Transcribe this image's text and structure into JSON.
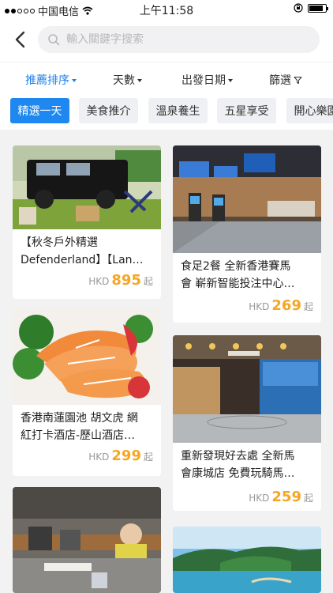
{
  "status": {
    "carrier": "中国电信",
    "time": "上午11:58",
    "battery_level": 0.85,
    "icons": [
      "signal-dots-icon",
      "wifi-icon",
      "orientation-lock-icon",
      "battery-icon"
    ]
  },
  "header": {
    "back_icon": "back-arrow-icon",
    "search_placeholder": "輸入關鍵字搜索",
    "search_icon": "search-icon"
  },
  "filters": [
    {
      "label": "推薦排序",
      "active": true
    },
    {
      "label": "天數",
      "active": false
    },
    {
      "label": "出發日期",
      "active": false
    },
    {
      "label": "篩選",
      "active": false,
      "icon": "filter-funnel-icon"
    }
  ],
  "chips": [
    {
      "label": "精選一天",
      "active": true
    },
    {
      "label": "美食推介",
      "active": false
    },
    {
      "label": "溫泉養生",
      "active": false
    },
    {
      "label": "五星享受",
      "active": false
    },
    {
      "label": "開心樂園",
      "active": false
    }
  ],
  "colors": {
    "accent": "#1f7ff0",
    "price": "#f5a623",
    "chip_active": "#1e88f0"
  },
  "products": [
    {
      "title_lines": [
        "【秋冬戶外精選",
        "Defenderland】【Lan…"
      ],
      "currency": "HKD",
      "price": "895",
      "suffix": "起"
    },
    {
      "title_lines": [
        "食足2餐 全新香港賽馬",
        "會 嶄新智能投注中心…"
      ],
      "currency": "HKD",
      "price": "269",
      "suffix": "起"
    },
    {
      "title_lines": [
        "香港南蓮園池 胡文虎 網",
        "紅打卡酒店-歷山酒店…"
      ],
      "currency": "HKD",
      "price": "299",
      "suffix": "起"
    },
    {
      "title_lines": [
        "重新發現好去處 全新馬",
        "會康城店 免費玩騎馬…"
      ],
      "currency": "HKD",
      "price": "259",
      "suffix": "起"
    }
  ]
}
